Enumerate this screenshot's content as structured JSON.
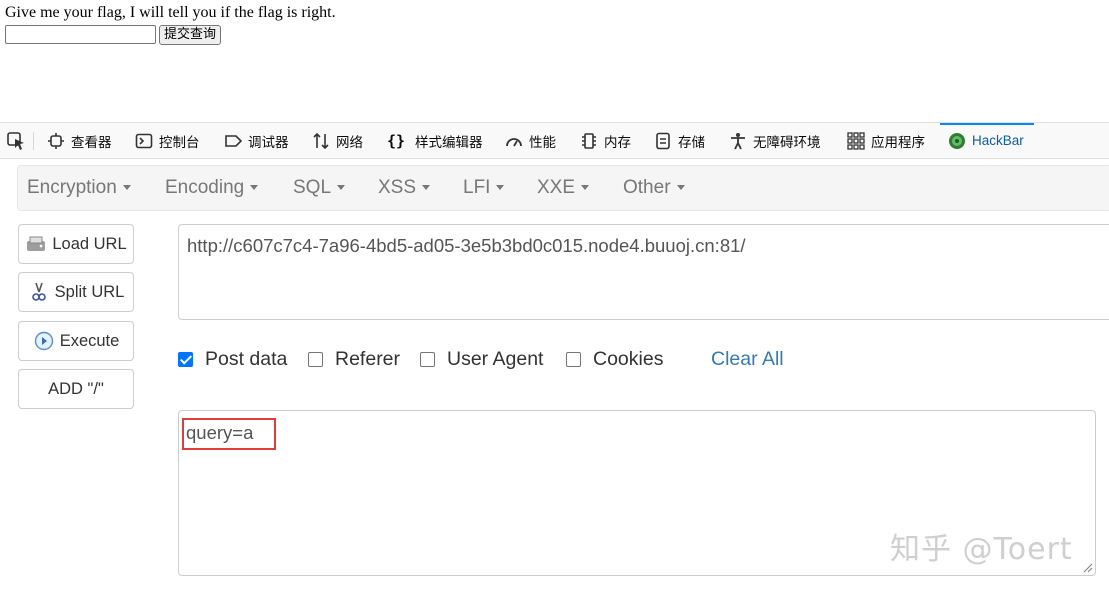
{
  "page": {
    "prompt": "Give me your flag, I will tell you if the flag is right.",
    "flag_input_value": "",
    "submit_label": "提交查询"
  },
  "devtools": {
    "tabs": [
      {
        "label": "查看器",
        "icon": "inspector-icon"
      },
      {
        "label": "控制台",
        "icon": "console-icon"
      },
      {
        "label": "调试器",
        "icon": "debugger-icon"
      },
      {
        "label": "网络",
        "icon": "network-icon"
      },
      {
        "label": "样式编辑器",
        "icon": "style-editor-icon"
      },
      {
        "label": "性能",
        "icon": "performance-icon"
      },
      {
        "label": "内存",
        "icon": "memory-icon"
      },
      {
        "label": "存储",
        "icon": "storage-icon"
      },
      {
        "label": "无障碍环境",
        "icon": "accessibility-icon"
      },
      {
        "label": "应用程序",
        "icon": "application-icon"
      },
      {
        "label": "HackBar",
        "icon": "hackbar-icon",
        "active": true
      }
    ]
  },
  "hackbar": {
    "menus": [
      "Encryption",
      "Encoding",
      "SQL",
      "XSS",
      "LFI",
      "XXE",
      "Other"
    ],
    "buttons": {
      "load_url": "Load URL",
      "split_url": "Split URL",
      "execute": "Execute",
      "add_slash": "ADD \"/\""
    },
    "url": "http://c607c7c4-7a96-4bd5-ad05-3e5b3bd0c015.node4.buuoj.cn:81/",
    "options": {
      "post_data": {
        "label": "Post data",
        "checked": true
      },
      "referer": {
        "label": "Referer",
        "checked": false
      },
      "user_agent": {
        "label": "User Agent",
        "checked": false
      },
      "cookies": {
        "label": "Cookies",
        "checked": false
      }
    },
    "clear_all": "Clear All",
    "post_body": "query=a"
  },
  "watermark": "知乎 @Toert",
  "colors": {
    "accent": "#0a84ff",
    "link": "#337ab7",
    "highlight": "#e03c3c"
  }
}
